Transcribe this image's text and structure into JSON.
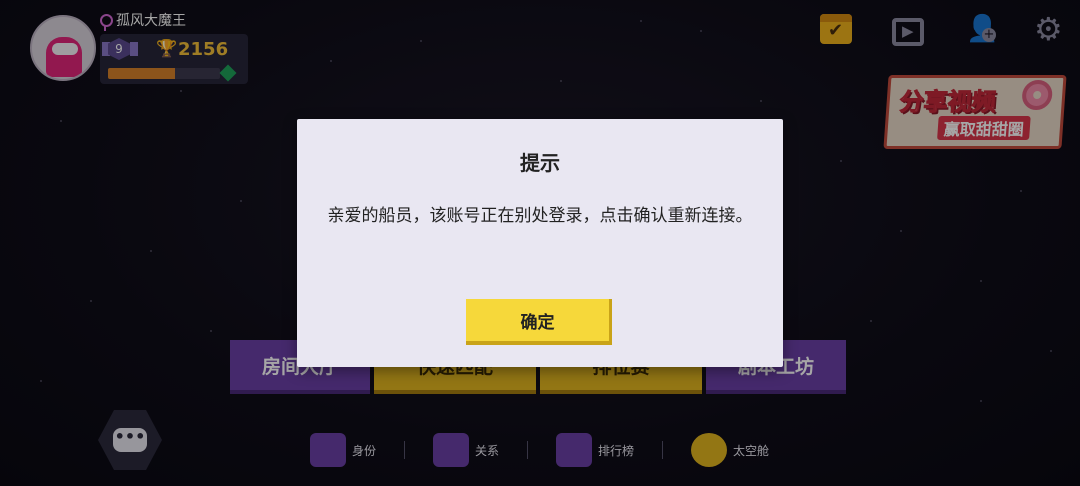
{
  "player": {
    "name": "孤风大魔王",
    "level": "9",
    "trophies": "2156",
    "xp_progress": 0.6
  },
  "top_icons": [
    "calendar-check-icon",
    "video-play-icon",
    "add-friend-icon",
    "gear-icon"
  ],
  "share_banner": {
    "title": "分享视频",
    "subtitle": "赢取甜甜圈"
  },
  "modes": [
    {
      "label": "房间大厅"
    },
    {
      "label": "快速匹配"
    },
    {
      "label": "排位赛"
    },
    {
      "label": "剧本工坊"
    }
  ],
  "bottom_nav": [
    {
      "label": "身份",
      "icon": "identity-card-icon"
    },
    {
      "label": "关系",
      "icon": "relationship-icon"
    },
    {
      "label": "排行榜",
      "icon": "leaderboard-icon"
    },
    {
      "label": "太空舱",
      "icon": "space-capsule-icon"
    }
  ],
  "dialog": {
    "title": "提示",
    "message": "亲爱的船员，该账号正在别处登录，点击确认重新连接。",
    "confirm_label": "确定"
  },
  "colors": {
    "accent_purple": "#6a3fa6",
    "accent_yellow": "#e2b51f",
    "button_yellow": "#f6d83a",
    "trophy_gold": "#f4c03a"
  }
}
